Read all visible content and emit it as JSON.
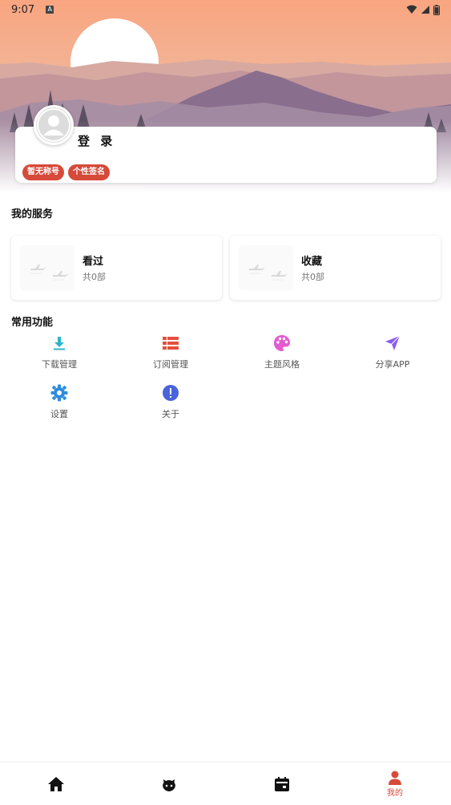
{
  "status_bar": {
    "time": "9:07",
    "indicator": "A"
  },
  "profile": {
    "login_label": "登 录",
    "tags": [
      "暂无称号",
      "个性签名"
    ]
  },
  "services": {
    "title": "我的服务",
    "items": [
      {
        "title": "看过",
        "count": "共0部"
      },
      {
        "title": "收藏",
        "count": "共0部"
      }
    ]
  },
  "functions": {
    "title": "常用功能",
    "items": [
      {
        "label": "下载管理",
        "icon": "download-icon",
        "color": "#2bb5c9"
      },
      {
        "label": "订阅管理",
        "icon": "list-icon",
        "color": "#e2503f"
      },
      {
        "label": "主题风格",
        "icon": "palette-icon",
        "color": "#e35bd0"
      },
      {
        "label": "分享APP",
        "icon": "send-icon",
        "color": "#8a5cf5"
      },
      {
        "label": "设置",
        "icon": "gear-icon",
        "color": "#2d8be0"
      },
      {
        "label": "关于",
        "icon": "info-icon",
        "color": "#4a63dc"
      }
    ]
  },
  "bottom_nav": {
    "items": [
      {
        "icon": "home-icon",
        "label": ""
      },
      {
        "icon": "face-icon",
        "label": ""
      },
      {
        "icon": "calendar-icon",
        "label": ""
      },
      {
        "icon": "person-icon",
        "label": "我的"
      }
    ],
    "active_color": "#d64a3a"
  }
}
